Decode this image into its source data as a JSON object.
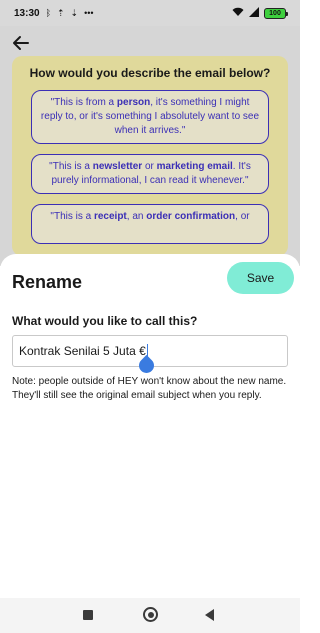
{
  "status_bar": {
    "time": "13:30",
    "left_icons": [
      "bluetooth-icon",
      "upload-icon",
      "download-icon",
      "more-icon"
    ],
    "right_icons": [
      "wifi-icon",
      "signal-icon",
      "battery-icon"
    ],
    "battery_level": "100"
  },
  "background_screen": {
    "question": "How would you describe the email below?",
    "options": [
      {
        "prefix": "\"This is from a ",
        "bold1": "person",
        "middle": ", it's something I might reply to, or it's something I absolutely want to see when it arrives.\"",
        "bold2": "",
        "suffix": ""
      },
      {
        "prefix": "\"This is a ",
        "bold1": "newsletter",
        "middle": " or ",
        "bold2": "marketing email",
        "suffix": ". It's purely informational, I can read it whenever.\""
      },
      {
        "prefix": "\"This is a ",
        "bold1": "receipt",
        "middle": ", an ",
        "bold2": "order confirmation",
        "suffix": ", or"
      }
    ]
  },
  "rename_sheet": {
    "title": "Rename",
    "save_label": "Save",
    "field_label": "What would you like to call this?",
    "input_value": "Kontrak Senilai 5 Juta €",
    "note": "Note: people outside of HEY won't know about the new name. They'll still see the original email subject when you reply."
  },
  "colors": {
    "save_button": "#80ecd6",
    "accent_purple": "#3b2fb6",
    "card_yellow": "#e0d99b",
    "cursor_blue": "#3a7be0"
  }
}
